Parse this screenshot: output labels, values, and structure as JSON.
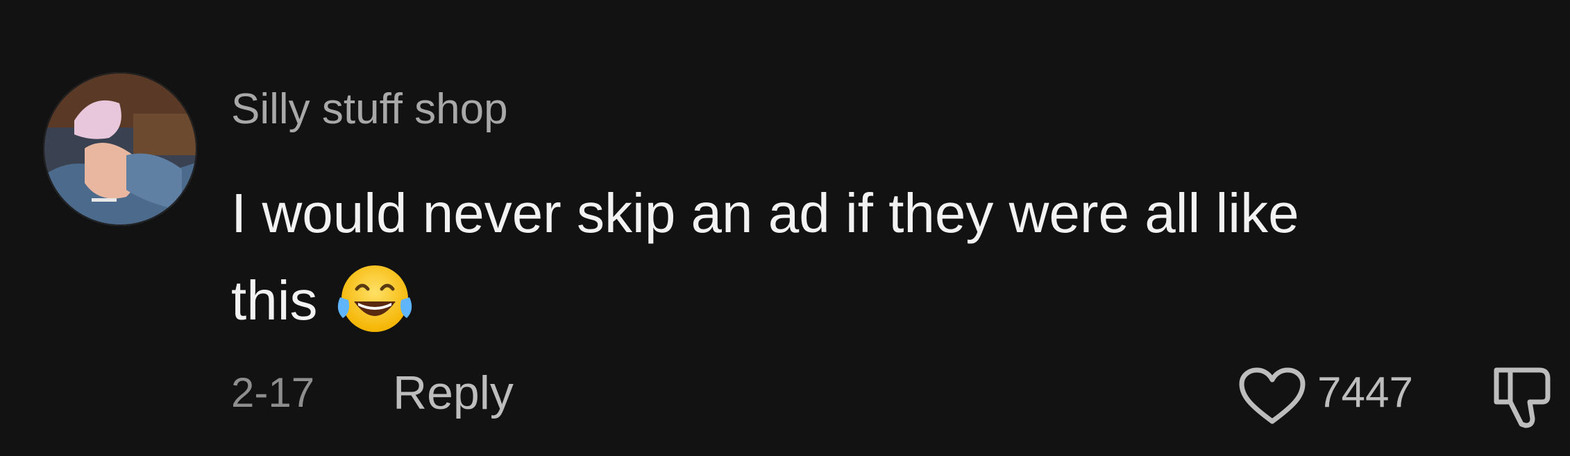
{
  "comment": {
    "username": "Silly stuff shop",
    "text_line_1": "I would never skip an ad if they were all like",
    "text_line_2": "this",
    "emoji": "face-with-tears-of-joy",
    "date": "2-17",
    "reply_label": "Reply",
    "like_count": "7447",
    "icons": {
      "like": "heart-outline-icon",
      "dislike": "thumbs-down-outline-icon"
    },
    "colors": {
      "background": "#121212",
      "username": "#a8a8a8",
      "text": "#f2f2f2",
      "meta": "#8e8e8e",
      "action": "#bdbdbd"
    }
  }
}
